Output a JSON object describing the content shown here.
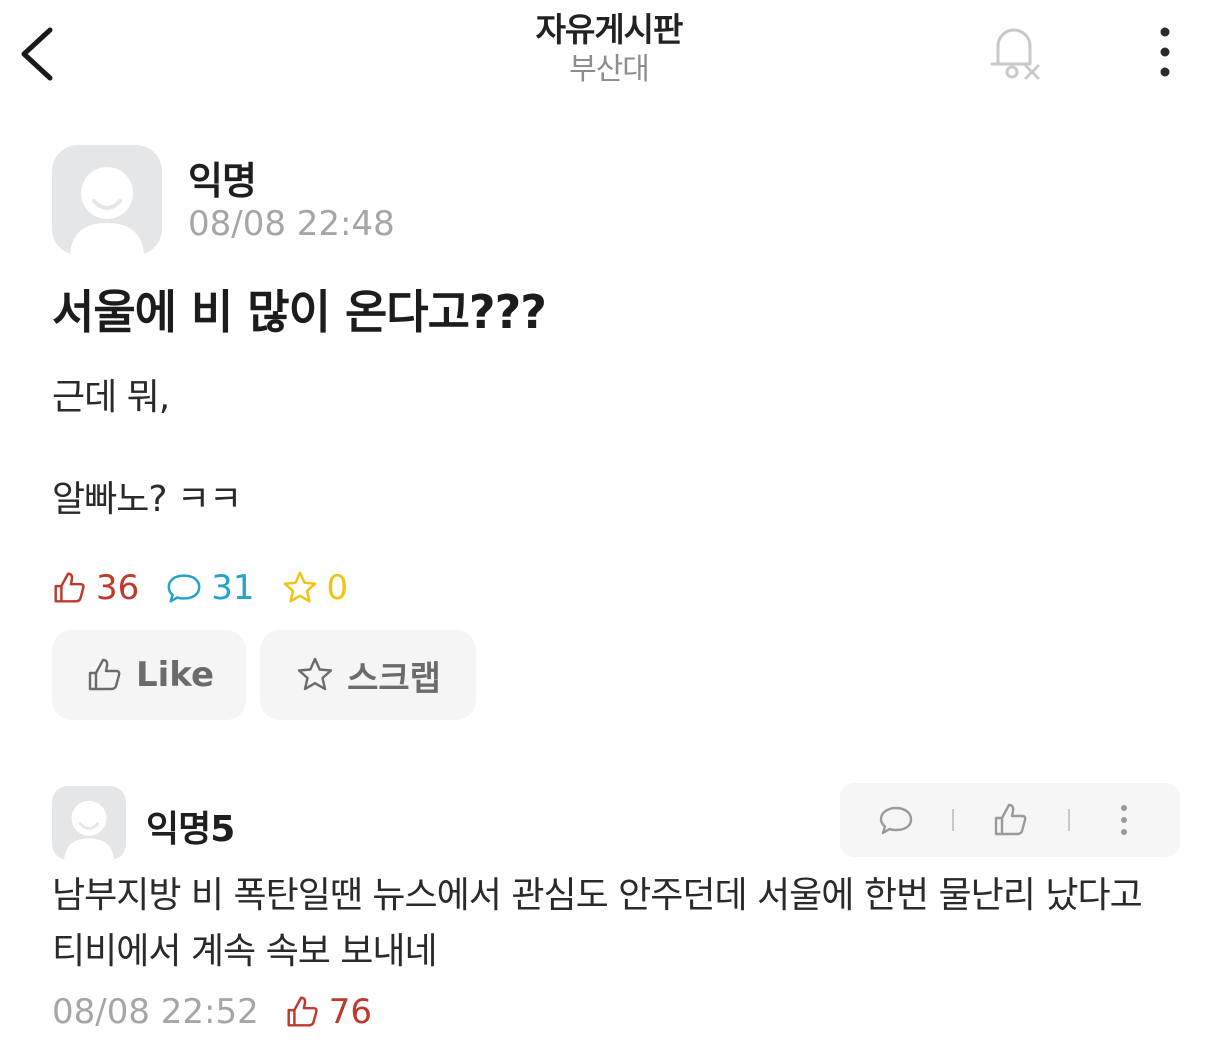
{
  "header": {
    "title": "자유게시판",
    "subtitle": "부산대"
  },
  "post": {
    "author": "익명",
    "time": "08/08 22:48",
    "title": "서울에 비 많이 온다고???",
    "body_lines": [
      "근데 뭐,",
      "알빠노? ㅋㅋ"
    ],
    "stats": {
      "likes": "36",
      "comments": "31",
      "scraps": "0"
    },
    "buttons": {
      "like_label": "Like",
      "scrap_label": "스크랩"
    }
  },
  "comment": {
    "author": "익명5",
    "text": "남부지방 비 폭탄일땐 뉴스에서 관심도 안주던데 서울에 한번 물난리 났다고 티비에서 계속 속보 보내네",
    "time": "08/08 22:52",
    "likes": "76"
  },
  "colors": {
    "like": "#c0392b",
    "comment": "#25a3c9",
    "scrap": "#f1c40f",
    "muted": "#a6a6a6",
    "avatar_bg": "#e4e6e8"
  },
  "icons": {
    "back": "chevron-left-icon",
    "bell": "bell-off-icon",
    "more": "more-vertical-icon",
    "like": "thumbs-up-icon",
    "comment": "comment-bubble-icon",
    "scrap": "star-icon"
  }
}
